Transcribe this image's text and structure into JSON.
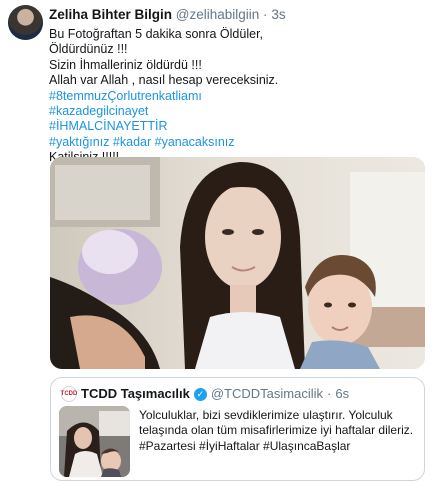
{
  "tweet": {
    "author_name": "Zeliha Bihter Bilgin",
    "author_handle": "@zelihabilgiin",
    "separator": "·",
    "time": "3s",
    "lines": [
      {
        "text": "Bu Fotoğraftan 5 dakika sonra Öldüler,",
        "hashtag": false
      },
      {
        "text": "Öldürdünüz !!!",
        "hashtag": false
      },
      {
        "text": "Sizin İhmalleriniz öldürdü !!!",
        "hashtag": false
      },
      {
        "text": "Allah var Allah , nasıl hesap vereceksiniz.",
        "hashtag": false
      },
      {
        "text": "#8temmuzÇorlutrenkatliamı",
        "hashtag": true
      },
      {
        "text": "#kazadegilcinayet",
        "hashtag": true
      },
      {
        "text": "#İHMALCİNAYETTİR",
        "hashtag": true
      },
      {
        "text": "#yaktığınız #kadar #yanacaksınız",
        "hashtag": true
      },
      {
        "text": "Katilsiniz !!!!!",
        "hashtag": false
      }
    ]
  },
  "quoted": {
    "author_name": "TCDD Taşımacılık",
    "author_handle": "@TCDDTasimacilik",
    "separator": "·",
    "time": "6s",
    "logo_text": "TCDD",
    "text_plain": "Yolculuklar, bizi sevdiklerimize ulaştırır. Yolculuk telaşında olan tüm misafirlerimize iyi haftalar dileriz. ",
    "text_hashtags": "#Pazartesi #İyiHaftalar #UlaşıncaBaşlar"
  },
  "colors": {
    "link": "#1b95e0",
    "secondary_text": "#657786",
    "primary_text": "#14171a",
    "verified": "#1da1f2",
    "border": "#ccd6dd"
  },
  "icons": {
    "verified": "verified-badge-icon"
  }
}
